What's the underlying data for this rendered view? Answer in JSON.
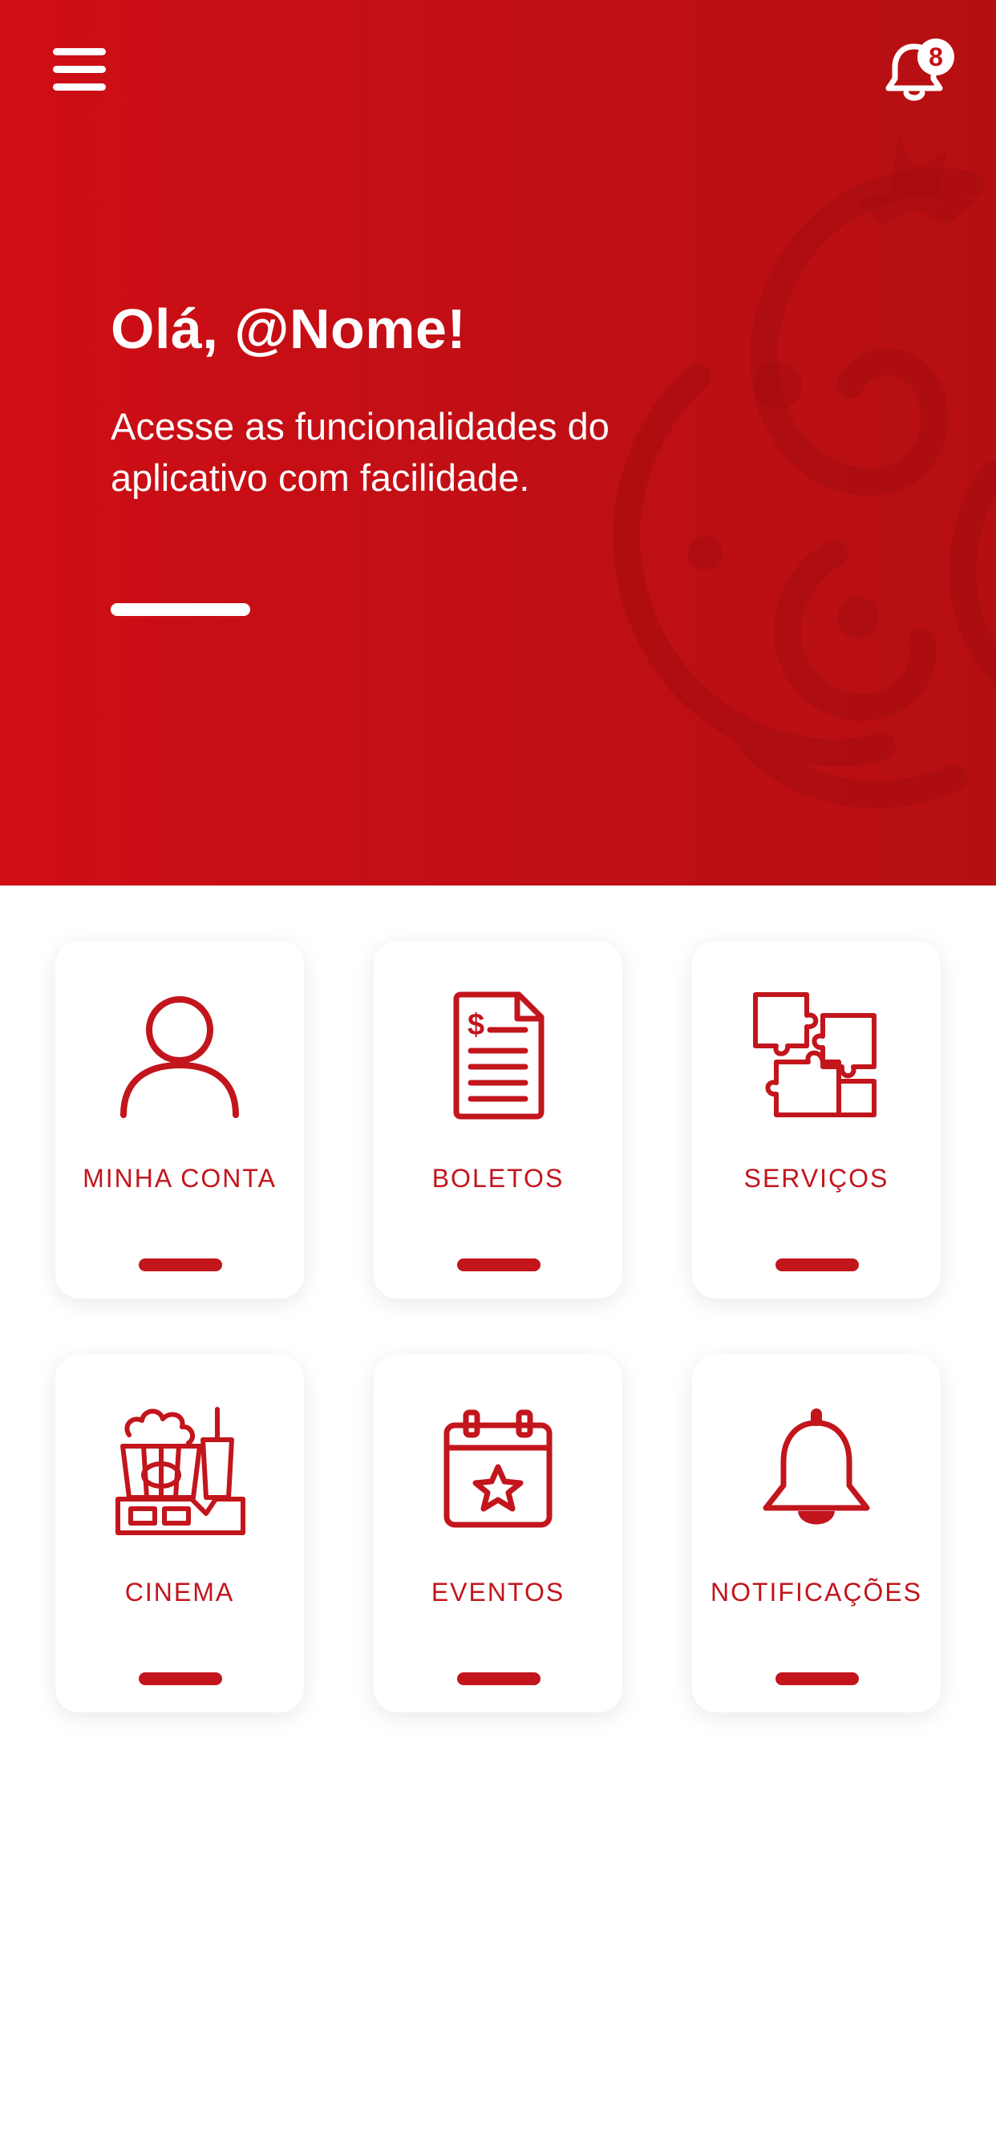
{
  "header": {
    "notification_count": "8",
    "greeting": "Olá, @Nome!",
    "subtitle": "Acesse as funcionalidades do aplicativo com facilidade."
  },
  "cards": [
    {
      "label": "MINHA CONTA",
      "icon": "user-icon"
    },
    {
      "label": "BOLETOS",
      "icon": "invoice-icon"
    },
    {
      "label": "SERVIÇOS",
      "icon": "puzzle-icon"
    },
    {
      "label": "CINEMA",
      "icon": "cinema-icon"
    },
    {
      "label": "EVENTOS",
      "icon": "calendar-star-icon"
    },
    {
      "label": "NOTIFICAÇÕES",
      "icon": "bell-icon"
    }
  ],
  "colors": {
    "primary": "#c40f15",
    "card_text": "#c2151c",
    "background": "#ffffff"
  }
}
